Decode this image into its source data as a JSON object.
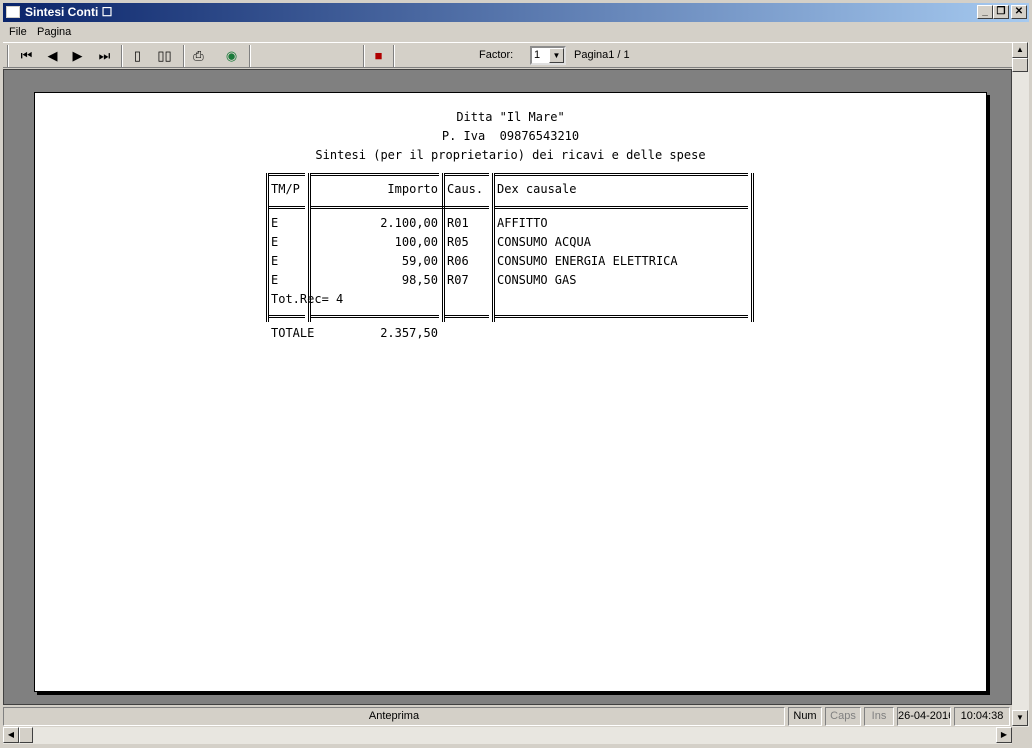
{
  "window": {
    "title": "Sintesi Conti ☐",
    "controls": {
      "minimize": "_",
      "maximize": "❐",
      "close": "✕"
    }
  },
  "menu": {
    "file": "File",
    "pagina": "Pagina"
  },
  "toolbar": {
    "icons": {
      "first": "⏮",
      "prev": "◀",
      "next": "▶",
      "last": "⏭",
      "single": "▯",
      "double": "▯▯",
      "print": "⎙",
      "export": "◉",
      "exit": "■"
    },
    "factor_label": "Factor:",
    "factor_value": "1",
    "factor_arrow": "▼",
    "page_label": "Pagina1 / 1"
  },
  "report": {
    "header1": "Ditta \"Il Mare\"",
    "header2": "P. Iva  09876543210",
    "header3": "Sintesi (per il proprietario) dei ricavi e delle spese",
    "columns": {
      "tmp": "TM/P",
      "importo": "Importo",
      "caus": "Caus.",
      "dex": "Dex causale"
    },
    "rows": [
      {
        "tmp": "E",
        "importo": "2.100,00",
        "caus": "R01",
        "dex": "AFFITTO"
      },
      {
        "tmp": "E",
        "importo": "100,00",
        "caus": "R05",
        "dex": "CONSUMO ACQUA"
      },
      {
        "tmp": "E",
        "importo": "59,00",
        "caus": "R06",
        "dex": "CONSUMO ENERGIA ELETTRICA"
      },
      {
        "tmp": "E",
        "importo": "98,50",
        "caus": "R07",
        "dex": "CONSUMO GAS"
      }
    ],
    "tot_rec": "Tot.Rec= 4",
    "totale_label": "TOTALE",
    "totale_value": "2.357,50"
  },
  "status": {
    "mode": "Anteprima",
    "num": "Num",
    "caps": "Caps",
    "ins": "Ins",
    "date": "26-04-2016",
    "time": "10:04:38"
  },
  "scroll": {
    "up": "▲",
    "down": "▼",
    "left": "◀",
    "right": "▶"
  }
}
